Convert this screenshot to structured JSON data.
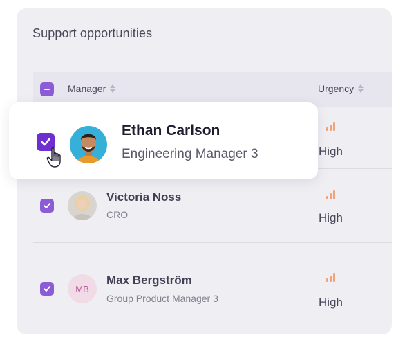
{
  "panel": {
    "title": "Support opportunities"
  },
  "table": {
    "headers": {
      "manager": "Manager",
      "urgency": "Urgency"
    },
    "rows": [
      {
        "name": "Victoria Noss",
        "role": "CRO",
        "urgency": "High",
        "avatar": "photo"
      },
      {
        "name": "Max Bergström",
        "role": "Group Product Manager 3",
        "urgency": "High",
        "avatar_initials": "MB"
      }
    ]
  },
  "selected_card": {
    "name": "Ethan Carlson",
    "role": "Engineering Manager 3",
    "urgency": "High",
    "avatar": "photo"
  },
  "icons": {
    "checkbox": "check-icon",
    "header_checkbox": "minus-icon",
    "sort": "sort-icon",
    "urgency": "signal-bars-icon",
    "cursor": "hand-pointer-icon"
  },
  "colors": {
    "accent": "#8b5cd6",
    "accent_dark": "#6f2fd0",
    "urgency": "#f0a27a"
  }
}
